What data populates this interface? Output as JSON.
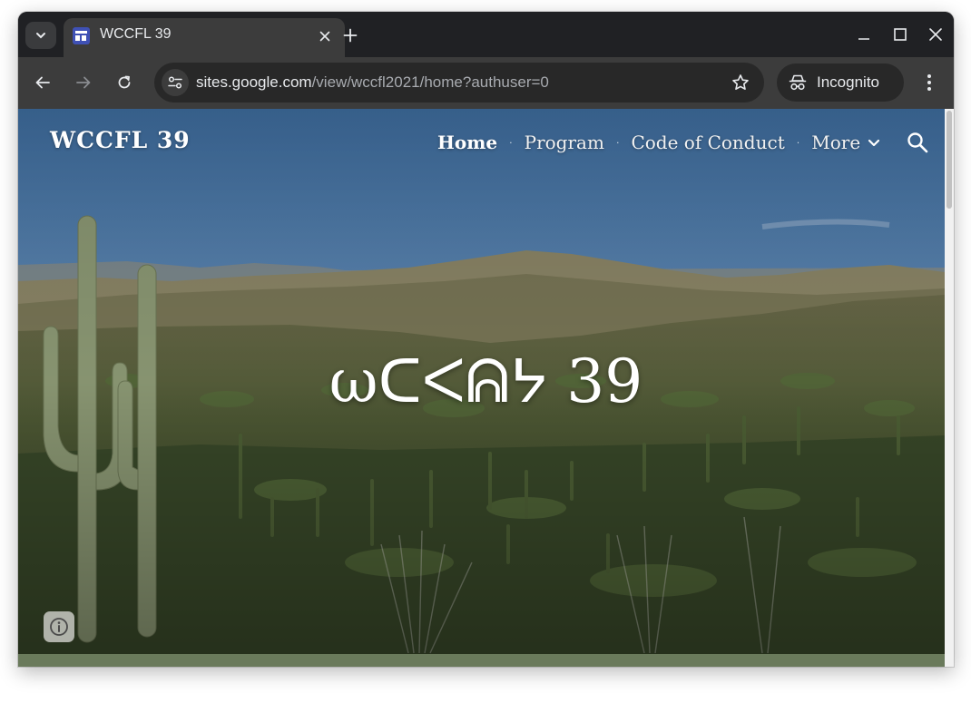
{
  "browser": {
    "tab": {
      "title": "WCCFL 39",
      "favicon": "google-sites-icon"
    },
    "url": {
      "host": "sites.google.com",
      "path": "/view/wccfl2021/home?authuser=0"
    },
    "profile_label": "Incognito",
    "colors": {
      "frame": "#202124",
      "toolbar": "#3c3c3c",
      "omnibox": "#282828"
    }
  },
  "site": {
    "title": "WCCFL 39",
    "nav": {
      "home": "Home",
      "program": "Program",
      "conduct": "Code of Conduct",
      "more": "More",
      "separator": "·"
    },
    "hero_title": "ωᑕᐸᕱᔭ 39",
    "hero_image": "saguaro-desert-landscape",
    "colors": {
      "text": "#ffffff",
      "band": "#6a7a5b"
    }
  }
}
